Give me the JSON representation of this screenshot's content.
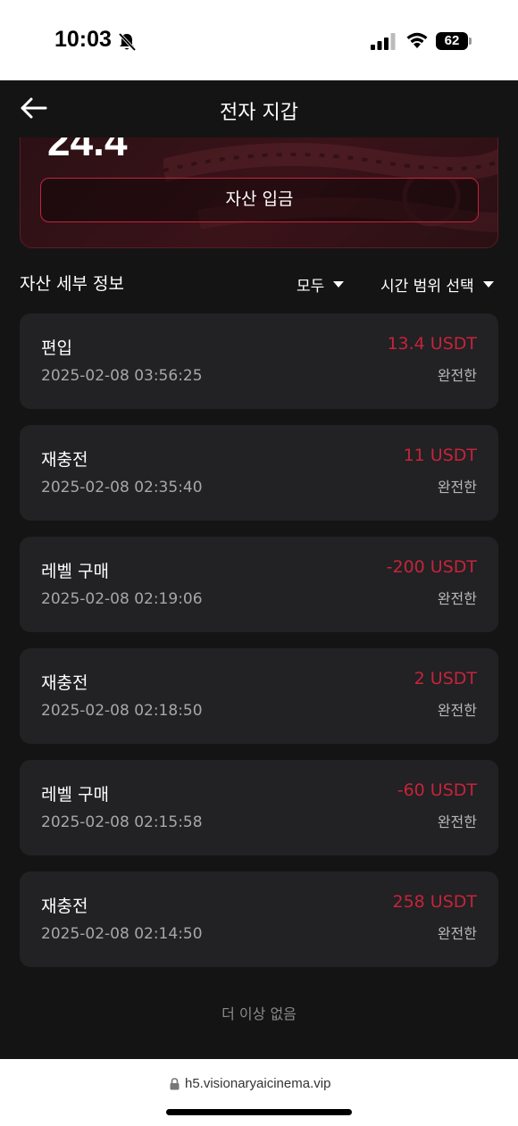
{
  "status_bar": {
    "time": "10:03",
    "battery": "62"
  },
  "header": {
    "title": "전자 지갑"
  },
  "balance": {
    "value": "24.4",
    "deposit_label": "자산 입금"
  },
  "section": {
    "title": "자산 세부 정보",
    "filter_all": "모두",
    "filter_time": "시간 범위 선택"
  },
  "transactions": [
    {
      "type": "편입",
      "date": "2025-02-08 03:56:25",
      "amount": "13.4 USDT",
      "status": "완전한"
    },
    {
      "type": "재충전",
      "date": "2025-02-08 02:35:40",
      "amount": "11 USDT",
      "status": "완전한"
    },
    {
      "type": "레벨 구매",
      "date": "2025-02-08 02:19:06",
      "amount": "-200 USDT",
      "status": "완전한"
    },
    {
      "type": "재충전",
      "date": "2025-02-08 02:18:50",
      "amount": "2 USDT",
      "status": "완전한"
    },
    {
      "type": "레벨 구매",
      "date": "2025-02-08 02:15:58",
      "amount": "-60 USDT",
      "status": "완전한"
    },
    {
      "type": "재충전",
      "date": "2025-02-08 02:14:50",
      "amount": "258 USDT",
      "status": "완전한"
    }
  ],
  "footer": {
    "no_more": "더 이상 없음"
  },
  "browser": {
    "url": "h5.visionaryaicinema.vip"
  },
  "colors": {
    "accent": "#c4243b",
    "background": "#151415",
    "card": "#222123"
  },
  "icons": {
    "back": "arrow-left-icon",
    "bell": "bell-slash-icon",
    "signal": "signal-icon",
    "wifi": "wifi-icon",
    "lock": "lock-icon"
  }
}
